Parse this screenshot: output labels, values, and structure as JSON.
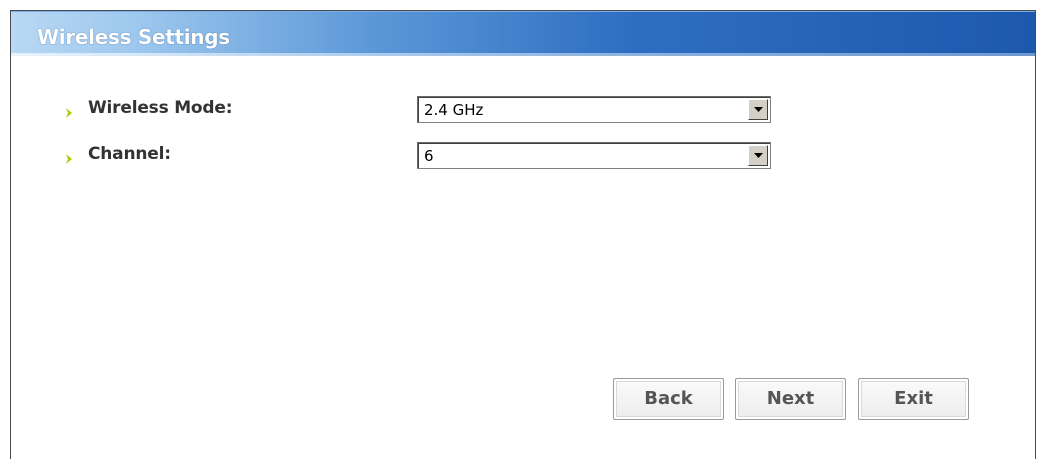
{
  "window": {
    "title": "Wireless Settings"
  },
  "fields": {
    "wireless_mode": {
      "label": "Wireless Mode:",
      "value": "2.4 GHz"
    },
    "channel": {
      "label": "Channel:",
      "value": "6"
    }
  },
  "buttons": {
    "back": "Back",
    "next": "Next",
    "exit": "Exit"
  },
  "colors": {
    "title_bar_accent": "#2f6fc2",
    "bullet_arrow": "#b5c900"
  },
  "icons": {
    "bullet": "chevron-right-icon",
    "dropdown": "caret-down-icon"
  }
}
